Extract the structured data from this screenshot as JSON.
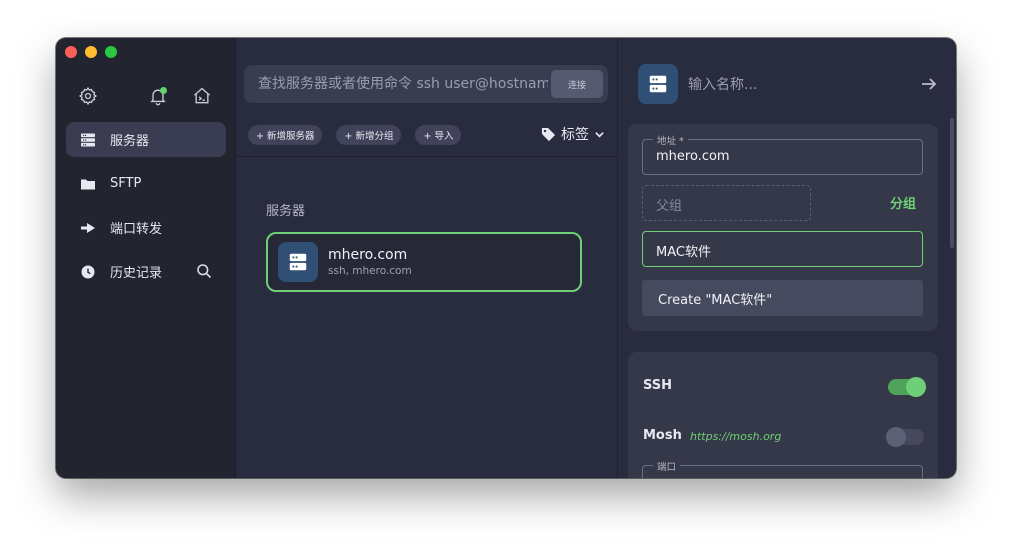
{
  "window": {
    "traffic_lights": [
      "close",
      "minimize",
      "zoom"
    ]
  },
  "sidebar": {
    "top_icons": [
      "gear-icon",
      "bell-icon",
      "home-terminal-icon"
    ],
    "items": [
      {
        "label": "服务器",
        "icon": "server-icon",
        "active": true
      },
      {
        "label": "SFTP",
        "icon": "folder-icon",
        "active": false
      },
      {
        "label": "端口转发",
        "icon": "port-forward-icon",
        "active": false
      },
      {
        "label": "历史记录",
        "icon": "clock-icon",
        "active": false
      }
    ]
  },
  "search": {
    "placeholder": "查找服务器或者使用命令 ssh user@hostname",
    "connect_label": "连接"
  },
  "toolbar": {
    "new_server": "+ 新增服务器",
    "new_group": "+ 新增分组",
    "import": "+ 导入",
    "tags": "标签"
  },
  "list": {
    "section_title": "服务器",
    "hosts": [
      {
        "name": "mhero.com",
        "sub": "ssh, mhero.com"
      }
    ]
  },
  "editor": {
    "name_placeholder": "输入名称...",
    "address_label": "地址 *",
    "address_value": "mhero.com",
    "parent_group_placeholder": "父组",
    "group_link": "分组",
    "group_input_value": "MAC软件",
    "create_suggestion": "Create \"MAC软件\"",
    "ssh_label": "SSH",
    "ssh_enabled": true,
    "mosh_label": "Mosh",
    "mosh_link": "https://mosh.org",
    "mosh_enabled": false,
    "port_label": "端口"
  },
  "colors": {
    "accent_green": "#6fcf76",
    "window_bg": "#292c3e",
    "sidebar_bg": "#22242f",
    "card_bg": "#353849",
    "icon_tile": "#2f4f74"
  }
}
